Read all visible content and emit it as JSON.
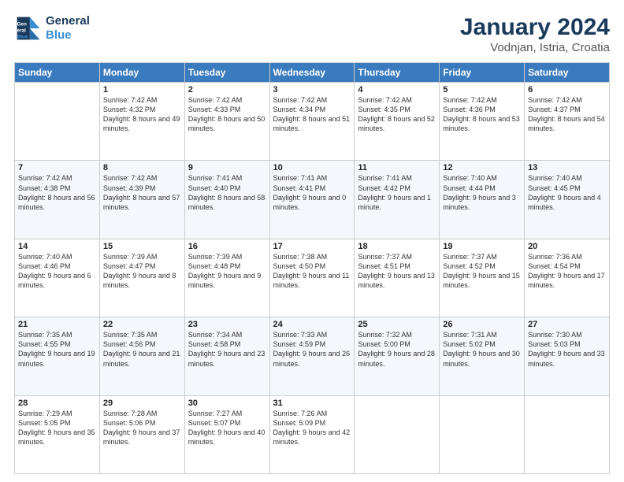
{
  "header": {
    "logo_line1": "General",
    "logo_line2": "Blue",
    "title": "January 2024",
    "subtitle": "Vodnjan, Istria, Croatia"
  },
  "weekdays": [
    "Sunday",
    "Monday",
    "Tuesday",
    "Wednesday",
    "Thursday",
    "Friday",
    "Saturday"
  ],
  "weeks": [
    [
      {
        "day": "",
        "sunrise": "",
        "sunset": "",
        "daylight": ""
      },
      {
        "day": "1",
        "sunrise": "Sunrise: 7:42 AM",
        "sunset": "Sunset: 4:32 PM",
        "daylight": "Daylight: 8 hours and 49 minutes."
      },
      {
        "day": "2",
        "sunrise": "Sunrise: 7:42 AM",
        "sunset": "Sunset: 4:33 PM",
        "daylight": "Daylight: 8 hours and 50 minutes."
      },
      {
        "day": "3",
        "sunrise": "Sunrise: 7:42 AM",
        "sunset": "Sunset: 4:34 PM",
        "daylight": "Daylight: 8 hours and 51 minutes."
      },
      {
        "day": "4",
        "sunrise": "Sunrise: 7:42 AM",
        "sunset": "Sunset: 4:35 PM",
        "daylight": "Daylight: 8 hours and 52 minutes."
      },
      {
        "day": "5",
        "sunrise": "Sunrise: 7:42 AM",
        "sunset": "Sunset: 4:36 PM",
        "daylight": "Daylight: 8 hours and 53 minutes."
      },
      {
        "day": "6",
        "sunrise": "Sunrise: 7:42 AM",
        "sunset": "Sunset: 4:37 PM",
        "daylight": "Daylight: 8 hours and 54 minutes."
      }
    ],
    [
      {
        "day": "7",
        "sunrise": "Sunrise: 7:42 AM",
        "sunset": "Sunset: 4:38 PM",
        "daylight": "Daylight: 8 hours and 56 minutes."
      },
      {
        "day": "8",
        "sunrise": "Sunrise: 7:42 AM",
        "sunset": "Sunset: 4:39 PM",
        "daylight": "Daylight: 8 hours and 57 minutes."
      },
      {
        "day": "9",
        "sunrise": "Sunrise: 7:41 AM",
        "sunset": "Sunset: 4:40 PM",
        "daylight": "Daylight: 8 hours and 58 minutes."
      },
      {
        "day": "10",
        "sunrise": "Sunrise: 7:41 AM",
        "sunset": "Sunset: 4:41 PM",
        "daylight": "Daylight: 9 hours and 0 minutes."
      },
      {
        "day": "11",
        "sunrise": "Sunrise: 7:41 AM",
        "sunset": "Sunset: 4:42 PM",
        "daylight": "Daylight: 9 hours and 1 minute."
      },
      {
        "day": "12",
        "sunrise": "Sunrise: 7:40 AM",
        "sunset": "Sunset: 4:44 PM",
        "daylight": "Daylight: 9 hours and 3 minutes."
      },
      {
        "day": "13",
        "sunrise": "Sunrise: 7:40 AM",
        "sunset": "Sunset: 4:45 PM",
        "daylight": "Daylight: 9 hours and 4 minutes."
      }
    ],
    [
      {
        "day": "14",
        "sunrise": "Sunrise: 7:40 AM",
        "sunset": "Sunset: 4:46 PM",
        "daylight": "Daylight: 9 hours and 6 minutes."
      },
      {
        "day": "15",
        "sunrise": "Sunrise: 7:39 AM",
        "sunset": "Sunset: 4:47 PM",
        "daylight": "Daylight: 9 hours and 8 minutes."
      },
      {
        "day": "16",
        "sunrise": "Sunrise: 7:39 AM",
        "sunset": "Sunset: 4:48 PM",
        "daylight": "Daylight: 9 hours and 9 minutes."
      },
      {
        "day": "17",
        "sunrise": "Sunrise: 7:38 AM",
        "sunset": "Sunset: 4:50 PM",
        "daylight": "Daylight: 9 hours and 11 minutes."
      },
      {
        "day": "18",
        "sunrise": "Sunrise: 7:37 AM",
        "sunset": "Sunset: 4:51 PM",
        "daylight": "Daylight: 9 hours and 13 minutes."
      },
      {
        "day": "19",
        "sunrise": "Sunrise: 7:37 AM",
        "sunset": "Sunset: 4:52 PM",
        "daylight": "Daylight: 9 hours and 15 minutes."
      },
      {
        "day": "20",
        "sunrise": "Sunrise: 7:36 AM",
        "sunset": "Sunset: 4:54 PM",
        "daylight": "Daylight: 9 hours and 17 minutes."
      }
    ],
    [
      {
        "day": "21",
        "sunrise": "Sunrise: 7:35 AM",
        "sunset": "Sunset: 4:55 PM",
        "daylight": "Daylight: 9 hours and 19 minutes."
      },
      {
        "day": "22",
        "sunrise": "Sunrise: 7:35 AM",
        "sunset": "Sunset: 4:56 PM",
        "daylight": "Daylight: 9 hours and 21 minutes."
      },
      {
        "day": "23",
        "sunrise": "Sunrise: 7:34 AM",
        "sunset": "Sunset: 4:58 PM",
        "daylight": "Daylight: 9 hours and 23 minutes."
      },
      {
        "day": "24",
        "sunrise": "Sunrise: 7:33 AM",
        "sunset": "Sunset: 4:59 PM",
        "daylight": "Daylight: 9 hours and 26 minutes."
      },
      {
        "day": "25",
        "sunrise": "Sunrise: 7:32 AM",
        "sunset": "Sunset: 5:00 PM",
        "daylight": "Daylight: 9 hours and 28 minutes."
      },
      {
        "day": "26",
        "sunrise": "Sunrise: 7:31 AM",
        "sunset": "Sunset: 5:02 PM",
        "daylight": "Daylight: 9 hours and 30 minutes."
      },
      {
        "day": "27",
        "sunrise": "Sunrise: 7:30 AM",
        "sunset": "Sunset: 5:03 PM",
        "daylight": "Daylight: 9 hours and 33 minutes."
      }
    ],
    [
      {
        "day": "28",
        "sunrise": "Sunrise: 7:29 AM",
        "sunset": "Sunset: 5:05 PM",
        "daylight": "Daylight: 9 hours and 35 minutes."
      },
      {
        "day": "29",
        "sunrise": "Sunrise: 7:28 AM",
        "sunset": "Sunset: 5:06 PM",
        "daylight": "Daylight: 9 hours and 37 minutes."
      },
      {
        "day": "30",
        "sunrise": "Sunrise: 7:27 AM",
        "sunset": "Sunset: 5:07 PM",
        "daylight": "Daylight: 9 hours and 40 minutes."
      },
      {
        "day": "31",
        "sunrise": "Sunrise: 7:26 AM",
        "sunset": "Sunset: 5:09 PM",
        "daylight": "Daylight: 9 hours and 42 minutes."
      },
      {
        "day": "",
        "sunrise": "",
        "sunset": "",
        "daylight": ""
      },
      {
        "day": "",
        "sunrise": "",
        "sunset": "",
        "daylight": ""
      },
      {
        "day": "",
        "sunrise": "",
        "sunset": "",
        "daylight": ""
      }
    ]
  ]
}
